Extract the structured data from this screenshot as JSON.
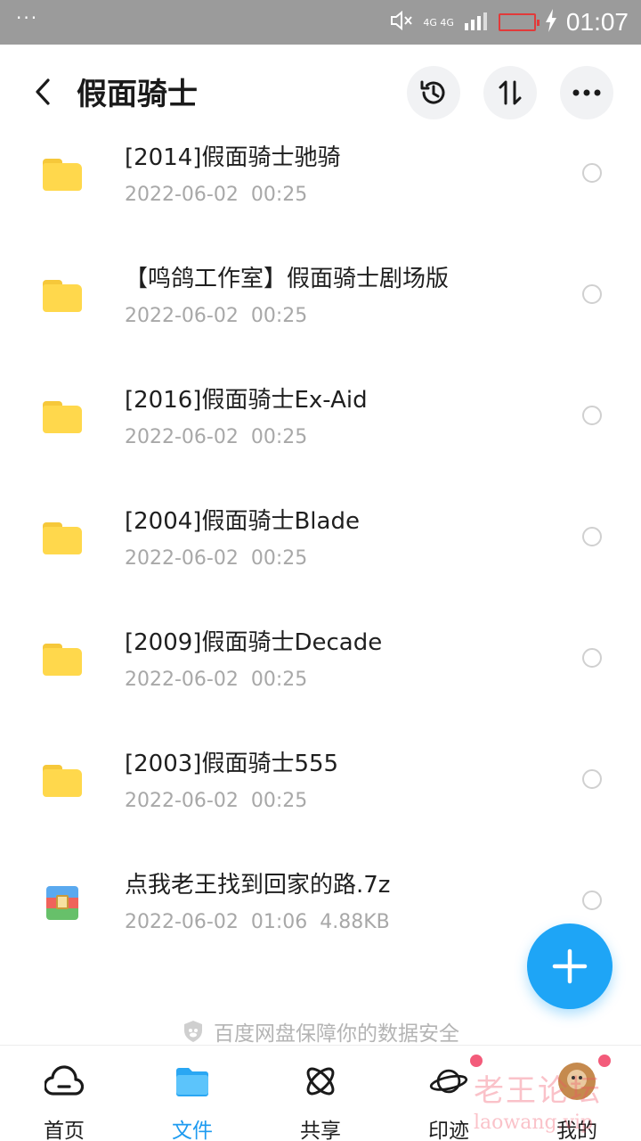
{
  "status_bar": {
    "dots": "···",
    "network": "4G 4G",
    "time": "01:07"
  },
  "header": {
    "title": "假面骑士"
  },
  "files": [
    {
      "name": "[2014]假面骑士驰骑",
      "date": "2022-06-02",
      "time": "00:25",
      "size": "",
      "type": "folder"
    },
    {
      "name": "【鸣鸽工作室】假面骑士剧场版",
      "date": "2022-06-02",
      "time": "00:25",
      "size": "",
      "type": "folder"
    },
    {
      "name": "[2016]假面骑士Ex-Aid",
      "date": "2022-06-02",
      "time": "00:25",
      "size": "",
      "type": "folder"
    },
    {
      "name": "[2004]假面骑士Blade",
      "date": "2022-06-02",
      "time": "00:25",
      "size": "",
      "type": "folder"
    },
    {
      "name": "[2009]假面骑士Decade",
      "date": "2022-06-02",
      "time": "00:25",
      "size": "",
      "type": "folder"
    },
    {
      "name": "[2003]假面骑士555",
      "date": "2022-06-02",
      "time": "00:25",
      "size": "",
      "type": "folder"
    },
    {
      "name": "点我老王找到回家的路.7z",
      "date": "2022-06-02",
      "time": "01:06",
      "size": "4.88KB",
      "type": "archive"
    }
  ],
  "security_note": "百度网盘保障你的数据安全",
  "bottom_nav": [
    {
      "label": "首页",
      "icon": "home-cloud-icon"
    },
    {
      "label": "文件",
      "icon": "folder-icon",
      "active": true
    },
    {
      "label": "共享",
      "icon": "share-atom-icon"
    },
    {
      "label": "印迹",
      "icon": "planet-icon"
    },
    {
      "label": "我的",
      "icon": "avatar-icon"
    }
  ],
  "watermark": {
    "cn": "老王论坛",
    "en": "laowang.vip"
  },
  "colors": {
    "accent": "#1e9bf0",
    "fab": "#1ea5f6",
    "folder": "#ffd84c",
    "status_bar": "#9b9b9b",
    "notification_dot": "#f35b7a"
  }
}
